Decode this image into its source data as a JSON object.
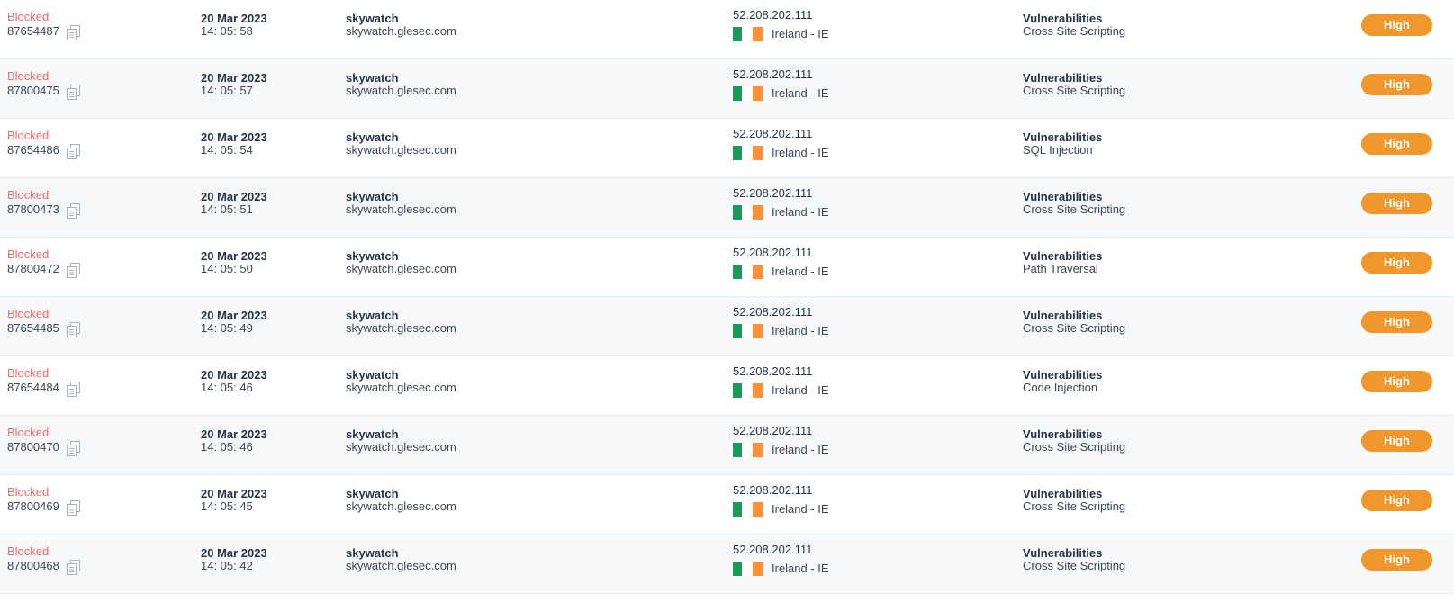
{
  "rows": [
    {
      "status": "Blocked",
      "id": "87654487",
      "date": "20 Mar 2023",
      "time": "14: 05: 58",
      "host": "skywatch",
      "domain": "skywatch.glesec.com",
      "ip": "52.208.202.111",
      "country": "Ireland - IE",
      "category": "Vulnerabilities",
      "type": "Cross Site Scripting",
      "severity": "High"
    },
    {
      "status": "Blocked",
      "id": "87800475",
      "date": "20 Mar 2023",
      "time": "14: 05: 57",
      "host": "skywatch",
      "domain": "skywatch.glesec.com",
      "ip": "52.208.202.111",
      "country": "Ireland - IE",
      "category": "Vulnerabilities",
      "type": "Cross Site Scripting",
      "severity": "High"
    },
    {
      "status": "Blocked",
      "id": "87654486",
      "date": "20 Mar 2023",
      "time": "14: 05: 54",
      "host": "skywatch",
      "domain": "skywatch.glesec.com",
      "ip": "52.208.202.111",
      "country": "Ireland - IE",
      "category": "Vulnerabilities",
      "type": "SQL Injection",
      "severity": "High"
    },
    {
      "status": "Blocked",
      "id": "87800473",
      "date": "20 Mar 2023",
      "time": "14: 05: 51",
      "host": "skywatch",
      "domain": "skywatch.glesec.com",
      "ip": "52.208.202.111",
      "country": "Ireland - IE",
      "category": "Vulnerabilities",
      "type": "Cross Site Scripting",
      "severity": "High"
    },
    {
      "status": "Blocked",
      "id": "87800472",
      "date": "20 Mar 2023",
      "time": "14: 05: 50",
      "host": "skywatch",
      "domain": "skywatch.glesec.com",
      "ip": "52.208.202.111",
      "country": "Ireland - IE",
      "category": "Vulnerabilities",
      "type": "Path Traversal",
      "severity": "High"
    },
    {
      "status": "Blocked",
      "id": "87654485",
      "date": "20 Mar 2023",
      "time": "14: 05: 49",
      "host": "skywatch",
      "domain": "skywatch.glesec.com",
      "ip": "52.208.202.111",
      "country": "Ireland - IE",
      "category": "Vulnerabilities",
      "type": "Cross Site Scripting",
      "severity": "High"
    },
    {
      "status": "Blocked",
      "id": "87654484",
      "date": "20 Mar 2023",
      "time": "14: 05: 46",
      "host": "skywatch",
      "domain": "skywatch.glesec.com",
      "ip": "52.208.202.111",
      "country": "Ireland - IE",
      "category": "Vulnerabilities",
      "type": "Code Injection",
      "severity": "High"
    },
    {
      "status": "Blocked",
      "id": "87800470",
      "date": "20 Mar 2023",
      "time": "14: 05: 46",
      "host": "skywatch",
      "domain": "skywatch.glesec.com",
      "ip": "52.208.202.111",
      "country": "Ireland - IE",
      "category": "Vulnerabilities",
      "type": "Cross Site Scripting",
      "severity": "High"
    },
    {
      "status": "Blocked",
      "id": "87800469",
      "date": "20 Mar 2023",
      "time": "14: 05: 45",
      "host": "skywatch",
      "domain": "skywatch.glesec.com",
      "ip": "52.208.202.111",
      "country": "Ireland - IE",
      "category": "Vulnerabilities",
      "type": "Cross Site Scripting",
      "severity": "High"
    },
    {
      "status": "Blocked",
      "id": "87800468",
      "date": "20 Mar 2023",
      "time": "14: 05: 42",
      "host": "skywatch",
      "domain": "skywatch.glesec.com",
      "ip": "52.208.202.111",
      "country": "Ireland - IE",
      "category": "Vulnerabilities",
      "type": "Cross Site Scripting",
      "severity": "High"
    }
  ],
  "icons": {
    "copy": "copy-icon",
    "flag": "ireland-flag-icon"
  },
  "colors": {
    "status_blocked": "#f06a6a",
    "severity_high": "#f0962a",
    "flag_green": "#1b9a5a",
    "flag_orange": "#ff8f3a",
    "row_alt_bg": "#f6f8fa",
    "text": "#243447"
  }
}
